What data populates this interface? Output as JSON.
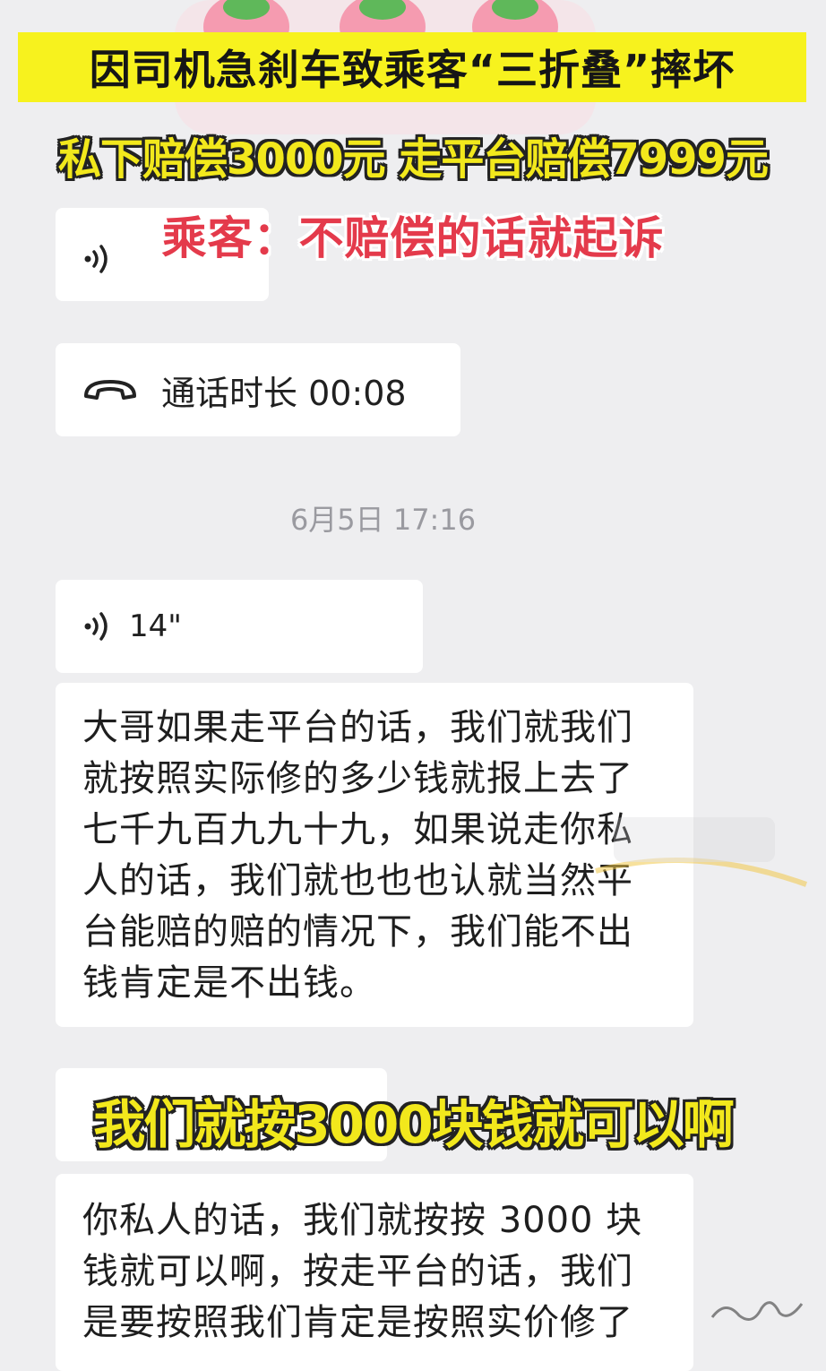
{
  "overlay": {
    "title": "因司机急刹车致乘客“三折叠”摔坏",
    "subtitle": "私下赔偿3000元 走平台赔偿7999元",
    "quote": "乘客：不赔偿的话就起诉",
    "caption2": "我们就按3000块钱就可以啊"
  },
  "chat": {
    "call_text": "通话时长 00:08",
    "timestamp": "6月5日 17:16",
    "voice_duration": "14\"",
    "message_1": "大哥如果走平台的话，我们就我们就按照实际修的多少钱就报上去了七千九百九九十九，如果说走你私人的话，我们就也也也认就当然平台能赔的赔的情况下，我们能不出钱肯定是不出钱。",
    "message_2": "你私人的话，我们就按按 3000 块钱就可以啊，按走平台的话，我们是要按照我们肯定是按照实价修了"
  },
  "icons": {
    "voice": "voice-wave-icon",
    "call": "phone-hangup-icon",
    "more": "more-dots-icon"
  },
  "colors": {
    "banner_yellow": "#f7f21e",
    "subtitle_yellow": "#f2e81c",
    "quote_red": "#e43a4b",
    "background": "#eeeef0",
    "bubble": "#ffffff"
  }
}
